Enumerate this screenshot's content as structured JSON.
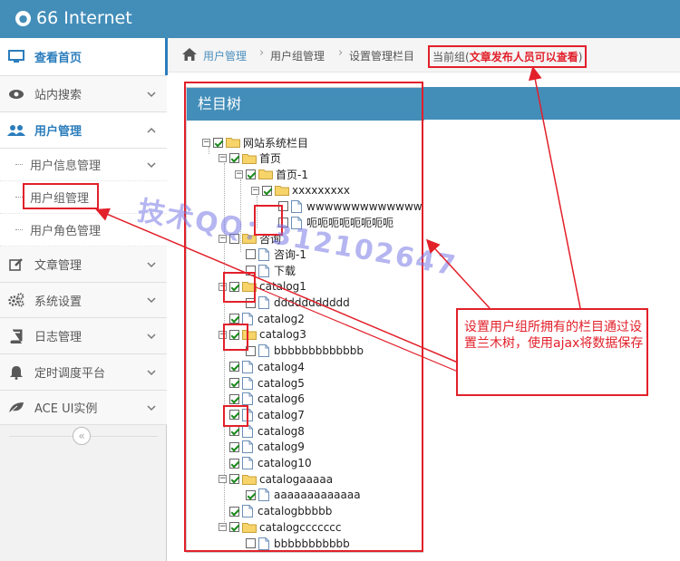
{
  "app": {
    "title": "66 Internet",
    "logo_icon": "globe-icon"
  },
  "colors": {
    "brand": "#438eb9",
    "link": "#4c8fbd",
    "annotation": "#e2202a",
    "check": "#1a8a1a",
    "folder": "#f6d46a"
  },
  "sidebar": {
    "items": [
      {
        "label": "查看首页",
        "icon": "monitor-icon"
      },
      {
        "label": "站内搜索",
        "icon": "eye-icon"
      },
      {
        "label": "用户管理",
        "icon": "users-icon"
      },
      {
        "label": "用户信息管理"
      },
      {
        "label": "用户组管理"
      },
      {
        "label": "用户角色管理"
      },
      {
        "label": "文章管理",
        "icon": "edit-icon"
      },
      {
        "label": "系统设置",
        "icon": "cogs-icon"
      },
      {
        "label": "日志管理",
        "icon": "book-icon"
      },
      {
        "label": "定时调度平台",
        "icon": "bell-icon"
      },
      {
        "label": "ACE UI实例",
        "icon": "leaf-icon"
      }
    ],
    "collapse_glyph": "«"
  },
  "breadcrumb": {
    "home_icon": "home-icon",
    "items": [
      "用户管理",
      "用户组管理",
      "设置管理栏目"
    ],
    "current_prefix": "当前组(",
    "current_group": "文章发布人员可以查看",
    "current_suffix": ")"
  },
  "panel": {
    "title": "栏目树"
  },
  "tree": [
    {
      "label": "网站系统栏目",
      "type": "folder",
      "checked": true,
      "toggle": "−"
    },
    {
      "label": "首页",
      "type": "folder",
      "checked": true,
      "toggle": "−"
    },
    {
      "label": "首页-1",
      "type": "folder",
      "checked": true,
      "toggle": "−"
    },
    {
      "label": "xxxxxxxxx",
      "type": "folder",
      "checked": true,
      "toggle": "−"
    },
    {
      "label": "wwwwwwwwwwwwwww",
      "type": "doc",
      "checked": false
    },
    {
      "label": "呃呃呃呃呃呃呃呃",
      "type": "doc",
      "checked": false
    },
    {
      "label": "咨询",
      "type": "folder",
      "checked": false,
      "toggle": "−"
    },
    {
      "label": "咨询-1",
      "type": "doc",
      "checked": false
    },
    {
      "label": "下载",
      "type": "doc",
      "checked": false
    },
    {
      "label": "catalog1",
      "type": "folder",
      "checked": true,
      "toggle": "−"
    },
    {
      "label": "ddddddddddd",
      "type": "doc",
      "checked": false
    },
    {
      "label": "catalog2",
      "type": "doc",
      "checked": true
    },
    {
      "label": "catalog3",
      "type": "folder",
      "checked": true,
      "toggle": "−"
    },
    {
      "label": "bbbbbbbbbbbbb",
      "type": "doc",
      "checked": false
    },
    {
      "label": "catalog4",
      "type": "doc",
      "checked": true
    },
    {
      "label": "catalog5",
      "type": "doc",
      "checked": true
    },
    {
      "label": "catalog6",
      "type": "doc",
      "checked": true
    },
    {
      "label": "catalog7",
      "type": "doc",
      "checked": true
    },
    {
      "label": "catalog8",
      "type": "doc",
      "checked": true
    },
    {
      "label": "catalog9",
      "type": "doc",
      "checked": true
    },
    {
      "label": "catalog10",
      "type": "doc",
      "checked": true
    },
    {
      "label": "catalogaaaaa",
      "type": "folder",
      "checked": true,
      "toggle": "−"
    },
    {
      "label": "aaaaaaaaaaaaa",
      "type": "doc",
      "checked": true
    },
    {
      "label": "catalogbbbbb",
      "type": "doc",
      "checked": true
    },
    {
      "label": "catalogccccccc",
      "type": "folder",
      "checked": true,
      "toggle": "−"
    },
    {
      "label": "bbbbbbbbbbb",
      "type": "doc",
      "checked": false
    }
  ],
  "annotation": {
    "text": "设置用户组所拥有的栏目通过设置兰木树，使用ajax将数据保存"
  },
  "watermark": {
    "text": "技术QQ：312102647"
  }
}
